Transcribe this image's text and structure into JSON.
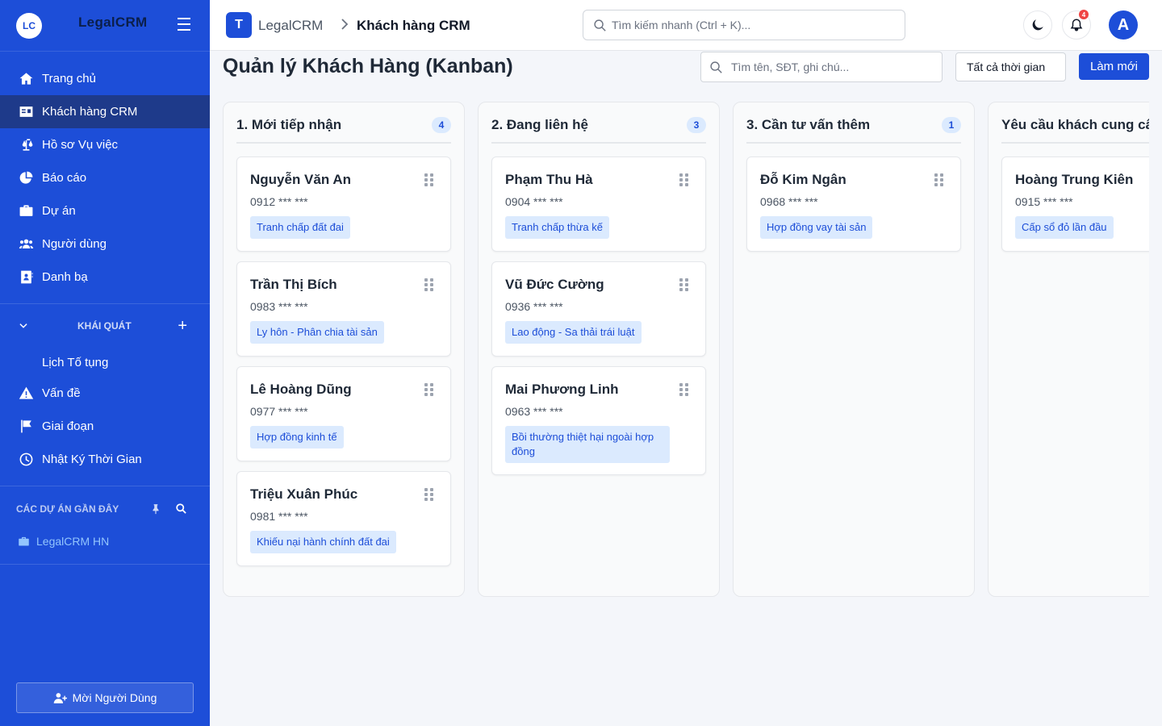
{
  "sidebar": {
    "logo_initials": "LC",
    "brand": "LegalCRM",
    "nav": [
      {
        "label": "Trang chủ",
        "icon": "home-icon"
      },
      {
        "label": "Khách hàng CRM",
        "icon": "id-card-icon",
        "active": true
      },
      {
        "label": "Hồ sơ Vụ việc",
        "icon": "scale-icon"
      },
      {
        "label": "Báo cáo",
        "icon": "pie-chart-icon"
      },
      {
        "label": "Dự án",
        "icon": "briefcase-icon"
      },
      {
        "label": "Người dùng",
        "icon": "users-icon"
      },
      {
        "label": "Danh bạ",
        "icon": "address-book-icon"
      }
    ],
    "section_title": "KHÁI QUÁT",
    "section_items": [
      {
        "label": "Lịch Tố tụng",
        "icon": ""
      },
      {
        "label": "Vấn đề",
        "icon": "warning-icon"
      },
      {
        "label": "Giai đoạn",
        "icon": "flag-icon"
      },
      {
        "label": "Nhật Ký Thời Gian",
        "icon": "clock-icon"
      }
    ],
    "recent_title": "CÁC DỰ ÁN GẦN ĐÂY",
    "recent_items": [
      {
        "label": "LegalCRM HN"
      }
    ],
    "invite_label": "Mời Người Dùng"
  },
  "topbar": {
    "logo_letter": "T",
    "brand": "LegalCRM",
    "page": "Khách hàng CRM",
    "search_placeholder": "Tìm kiếm nhanh (Ctrl + K)...",
    "notification_count": "4",
    "avatar_letter": "A"
  },
  "main": {
    "title": "Quản lý Khách Hàng (Kanban)",
    "search_placeholder": "Tìm tên, SĐT, ghi chú...",
    "time_filter": "Tất cả thời gian",
    "refresh_label": "Làm mới"
  },
  "columns": [
    {
      "title": "1. Mới tiếp nhận",
      "count": "4",
      "cards": [
        {
          "name": "Nguyễn Văn An",
          "phone": "0912 *** ***",
          "tag": "Tranh chấp đất đai"
        },
        {
          "name": "Trần Thị Bích",
          "phone": "0983 *** ***",
          "tag": "Ly hôn - Phân chia tài sản"
        },
        {
          "name": "Lê Hoàng Dũng",
          "phone": "0977 *** ***",
          "tag": "Hợp đồng kinh tế"
        },
        {
          "name": "Triệu Xuân Phúc",
          "phone": "0981 *** ***",
          "tag": "Khiếu nại hành chính đất đai"
        }
      ]
    },
    {
      "title": "2. Đang liên hệ",
      "count": "3",
      "cards": [
        {
          "name": "Phạm Thu Hà",
          "phone": "0904 *** ***",
          "tag": "Tranh chấp thừa kế"
        },
        {
          "name": "Vũ Đức Cường",
          "phone": "0936 *** ***",
          "tag": "Lao động - Sa thải trái luật"
        },
        {
          "name": "Mai Phương Linh",
          "phone": "0963 *** ***",
          "tag": "Bồi thường thiệt hại ngoài hợp đồng"
        }
      ]
    },
    {
      "title": "3. Cần tư vấn thêm",
      "count": "1",
      "cards": [
        {
          "name": "Đỗ Kim Ngân",
          "phone": "0968 *** ***",
          "tag": "Hợp đồng vay tài sản"
        }
      ]
    },
    {
      "title": "Yêu cầu khách cung cấp",
      "count": "",
      "cards": [
        {
          "name": "Hoàng Trung Kiên",
          "phone": "0915 *** ***",
          "tag": "Cấp sổ đỏ lần đầu"
        }
      ]
    }
  ]
}
